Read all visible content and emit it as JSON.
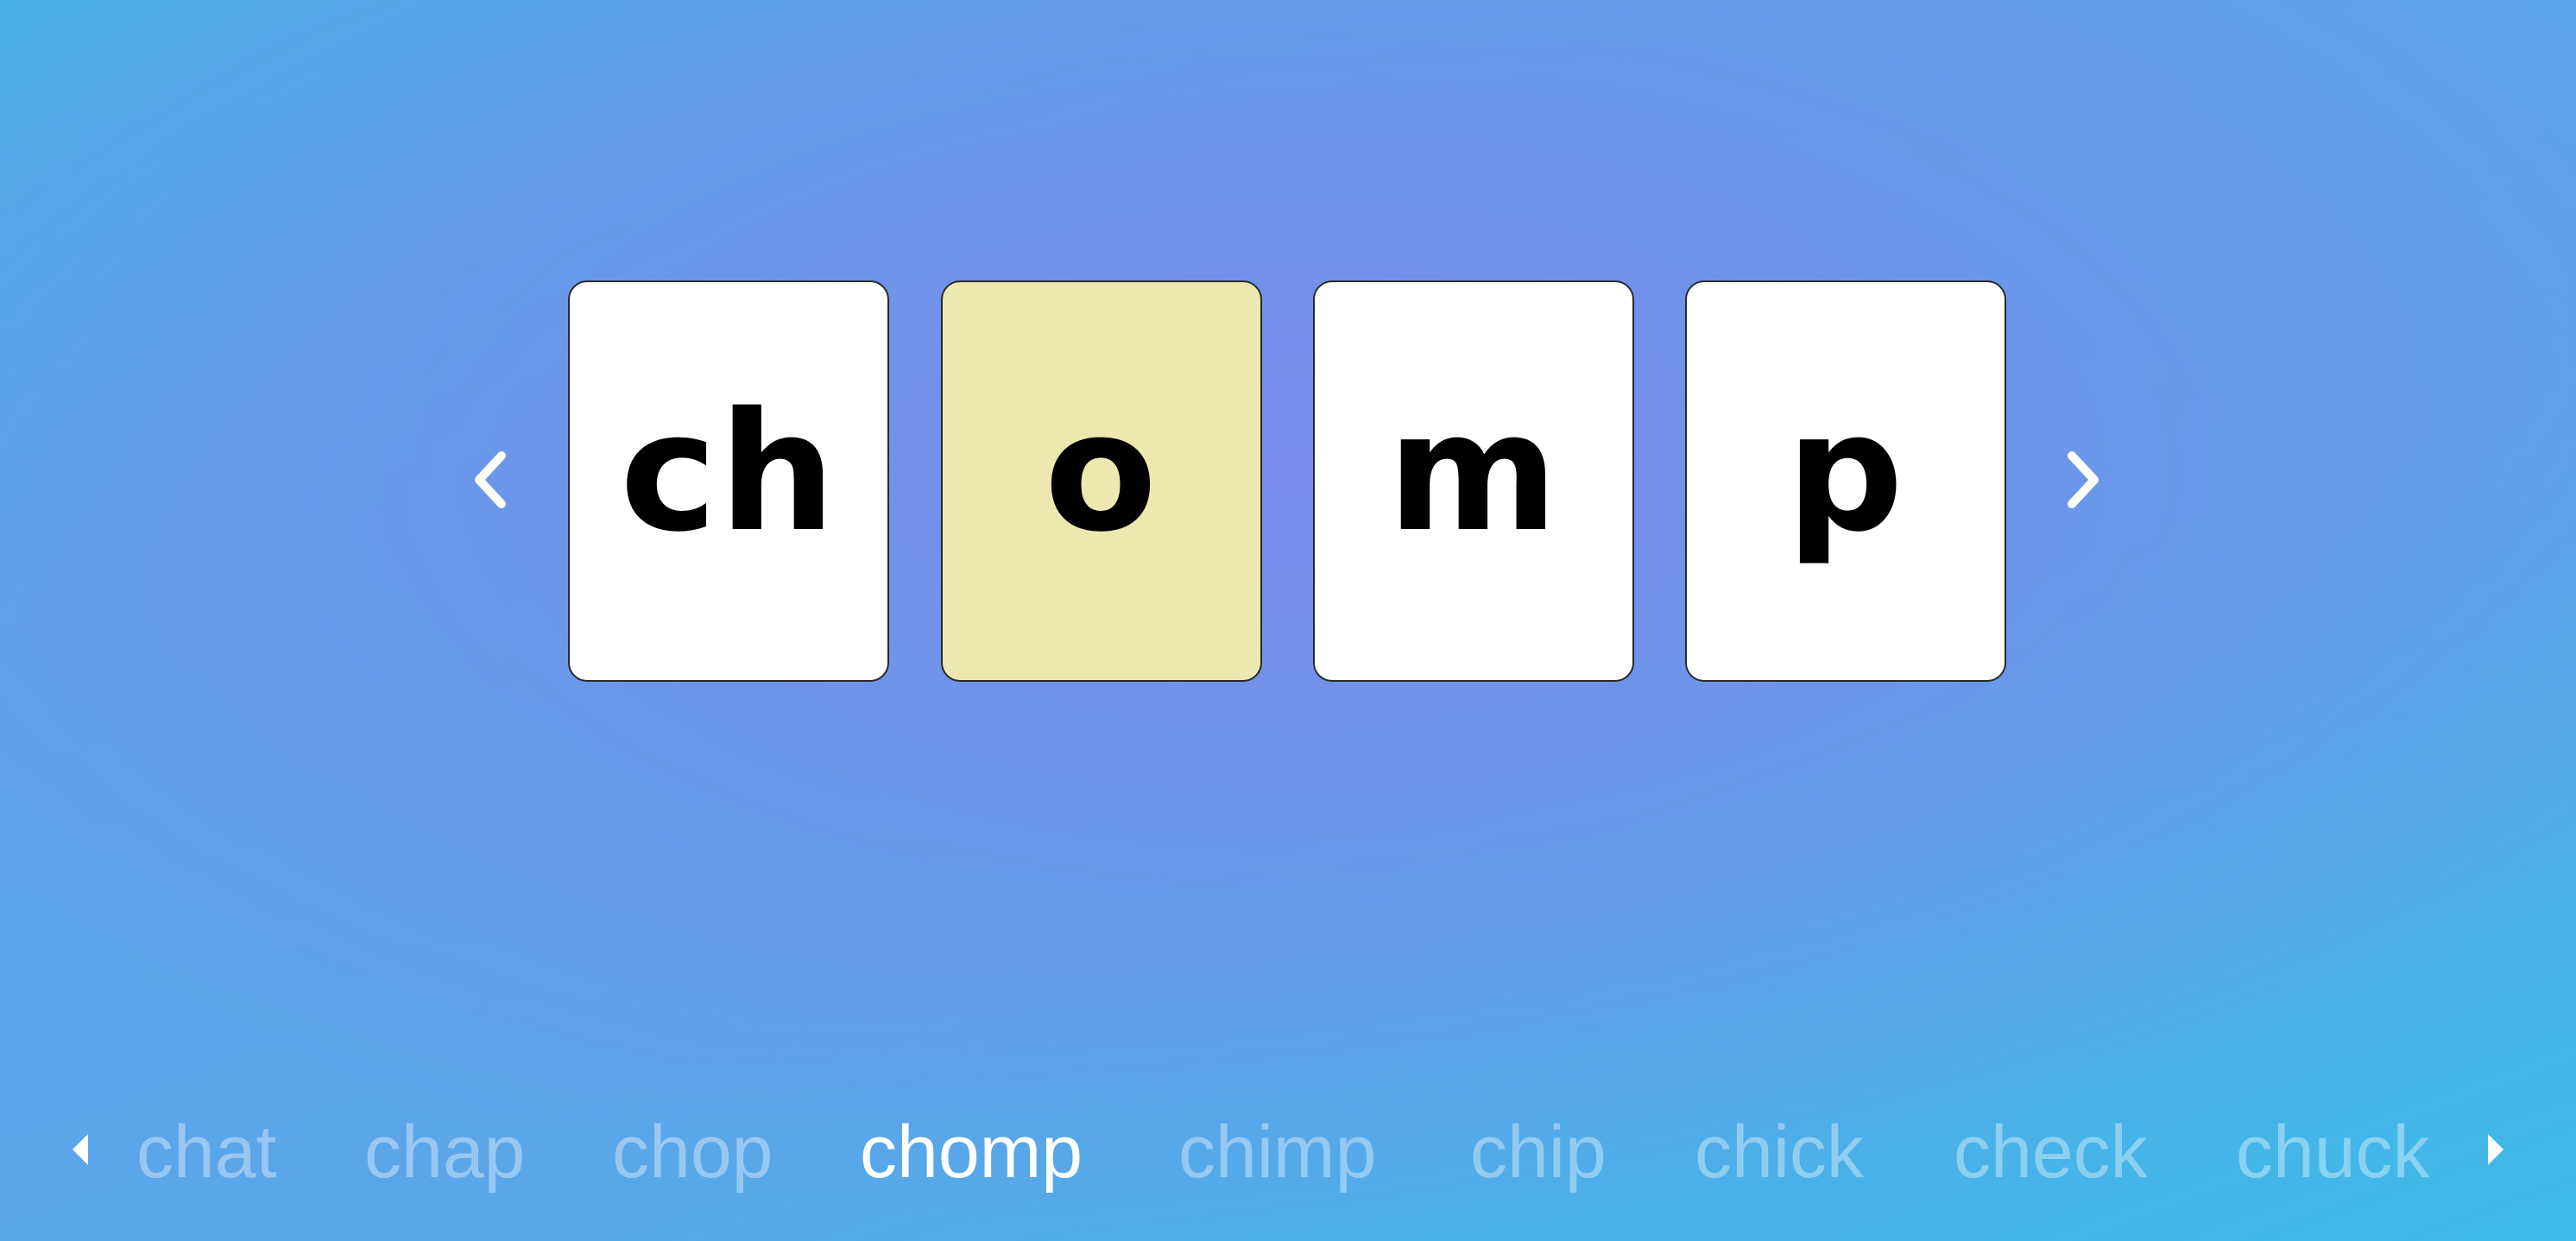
{
  "tiles": [
    {
      "text": "ch",
      "highlighted": false
    },
    {
      "text": "o",
      "highlighted": true
    },
    {
      "text": "m",
      "highlighted": false
    },
    {
      "text": "p",
      "highlighted": false
    }
  ],
  "word_list": {
    "words": [
      "chat",
      "chap",
      "chop",
      "chomp",
      "chimp",
      "chip",
      "chick",
      "check",
      "chuck"
    ],
    "active_word": "chomp"
  },
  "colors": {
    "tile_default": "#ffffff",
    "tile_highlight": "#ede8af",
    "background_start": "#4aaee8",
    "background_center": "#7a8aeb",
    "background_end": "#3dbae8",
    "word_inactive": "rgba(255,255,255,0.38)",
    "word_active": "#ffffff"
  },
  "icons": {
    "previous_tile": "chevron-left-icon",
    "next_tile": "chevron-right-icon",
    "previous_word": "triangle-left-icon",
    "next_word": "triangle-right-icon"
  }
}
